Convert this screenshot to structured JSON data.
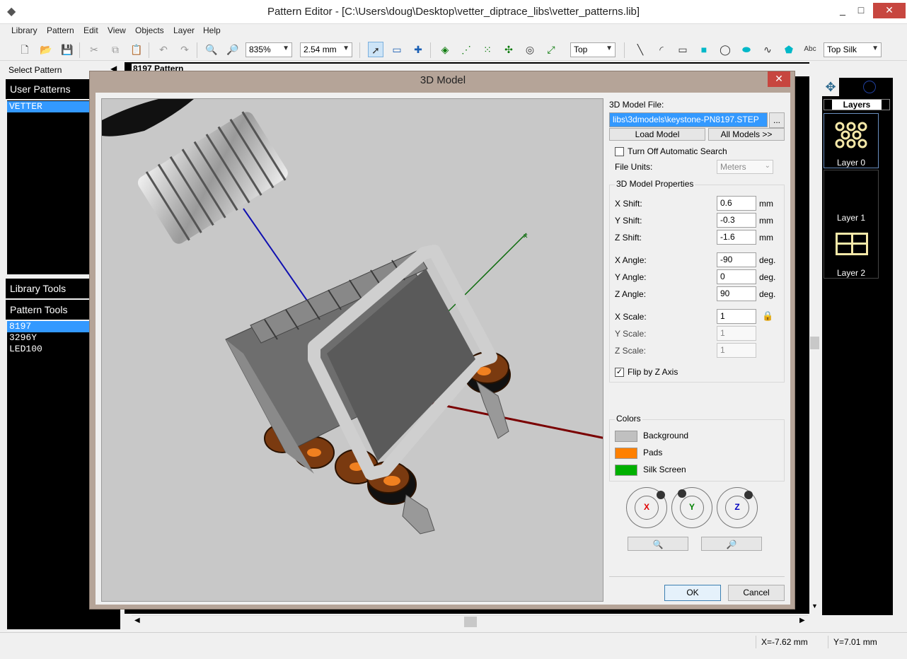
{
  "window": {
    "title": "Pattern Editor - [C:\\Users\\doug\\Desktop\\vetter_diptrace_libs\\vetter_patterns.lib]",
    "minimize": "_",
    "maximize": "□",
    "close": "✕"
  },
  "menu": [
    "Library",
    "Pattern",
    "Edit",
    "View",
    "Objects",
    "Layer",
    "Help"
  ],
  "toolbar": {
    "zoom": "835%",
    "grid": "2.54 mm",
    "side": "Top",
    "layer": "Top Silk",
    "text_tool": "Abc"
  },
  "left": {
    "select_pattern": "Select Pattern",
    "user_patterns": "User Patterns",
    "libraries": [
      "VETTER"
    ],
    "library_tools": "Library Tools",
    "pattern_tools": "Pattern Tools",
    "patterns": [
      "8197",
      "3296Y",
      "LED100"
    ]
  },
  "canvas_title": "8197 Pattern",
  "right": {
    "layers_title": "Layers",
    "layers": [
      "Layer 0",
      "Layer 1",
      "Layer 2"
    ]
  },
  "status": {
    "x": "X=-7.62 mm",
    "y": "Y=7.01 mm"
  },
  "dialog": {
    "title": "3D Model",
    "close": "✕",
    "model_file_label": "3D Model File:",
    "model_file_value": "libs\\3dmodels\\keystone-PN8197.STEP",
    "browse": "...",
    "load_model": "Load Model",
    "all_models": "All Models >>",
    "auto_search_label": "Turn Off Automatic Search",
    "auto_search_checked": false,
    "file_units_label": "File Units:",
    "file_units_value": "Meters",
    "props_title": "3D Model Properties",
    "props": [
      {
        "label": "X Shift:",
        "value": "0.6",
        "unit": "mm"
      },
      {
        "label": "Y Shift:",
        "value": "-0.3",
        "unit": "mm"
      },
      {
        "label": "Z Shift:",
        "value": "-1.6",
        "unit": "mm"
      },
      {
        "label": "X Angle:",
        "value": "-90",
        "unit": "deg."
      },
      {
        "label": "Y Angle:",
        "value": "0",
        "unit": "deg."
      },
      {
        "label": "Z Angle:",
        "value": "90",
        "unit": "deg."
      },
      {
        "label": "X Scale:",
        "value": "1",
        "unit": ""
      },
      {
        "label": "Y Scale:",
        "value": "1",
        "unit": ""
      },
      {
        "label": "Z Scale:",
        "value": "1",
        "unit": ""
      }
    ],
    "flip_label": "Flip by Z Axis",
    "flip_checked": true,
    "colors_title": "Colors",
    "colors": [
      {
        "label": "Background",
        "color": "#c0c0c0"
      },
      {
        "label": "Pads",
        "color": "#ff8000"
      },
      {
        "label": "Silk Screen",
        "color": "#00b000"
      }
    ],
    "axes": [
      "X",
      "Y",
      "Z"
    ],
    "axis_colors": {
      "X": "#e00000",
      "Y": "#008000",
      "Z": "#0000c0"
    },
    "ok": "OK",
    "cancel": "Cancel"
  }
}
